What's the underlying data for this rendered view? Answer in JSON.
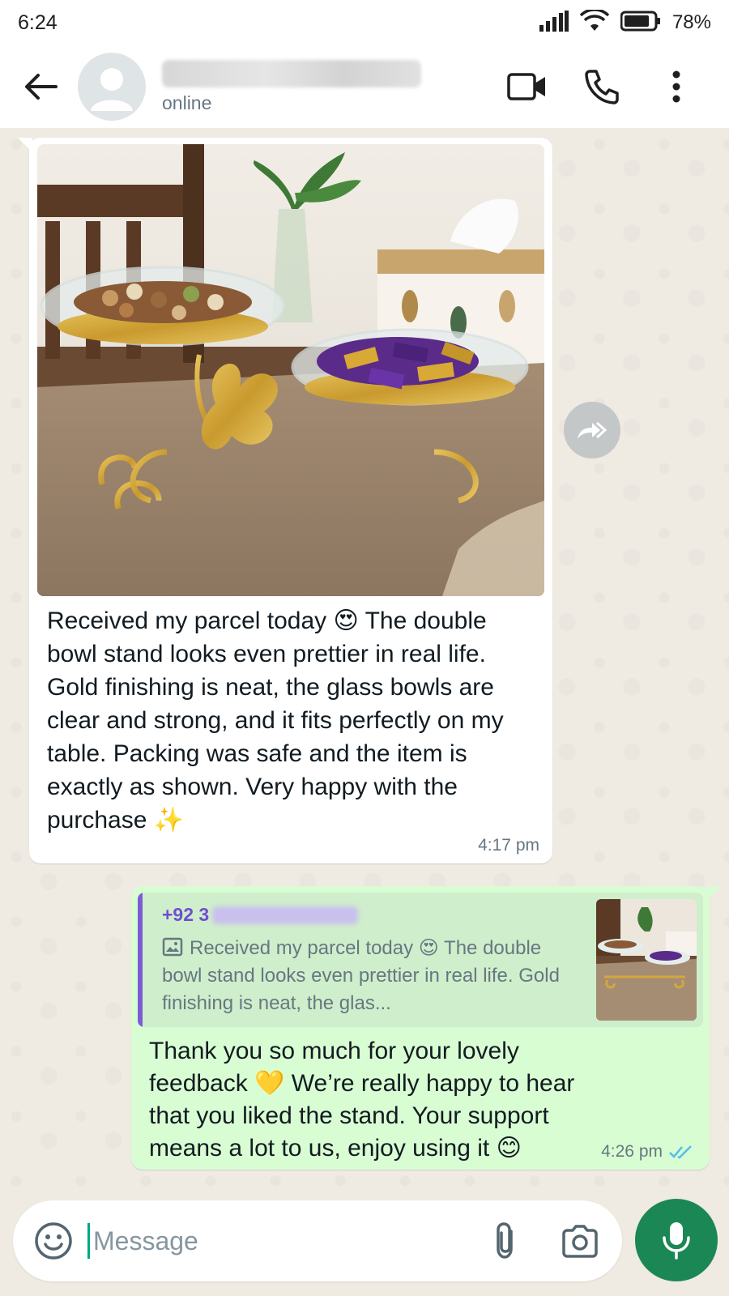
{
  "status_bar": {
    "time": "6:24",
    "battery": "78%"
  },
  "header": {
    "contact_status": "online",
    "icons": [
      "back-arrow-icon",
      "avatar-placeholder-icon",
      "video-call-icon",
      "voice-call-icon",
      "more-options-icon"
    ]
  },
  "messages": {
    "incoming": {
      "text": "Received my parcel today 😍 The double bowl stand looks even prettier in real life. Gold finishing is neat, the glass bowls are clear and strong, and it fits perfectly on my table. Packing was safe and the item is exactly as shown. Very happy with the purchase ✨",
      "time": "4:17 pm"
    },
    "outgoing": {
      "quote_sender": "+92 3",
      "quote_text": "Received my parcel today 😍 The double bowl stand looks even prettier in real life. Gold finishing is neat, the glas...",
      "text": "Thank you so much for your lovely feedback 💛 We’re really happy to hear that you liked the stand. Your support means a lot to us, enjoy using it 😊",
      "time": "4:26 pm",
      "status": "read"
    }
  },
  "input_bar": {
    "placeholder": "Message"
  },
  "colors": {
    "chat_background": "#efeae2",
    "outgoing_bubble": "#d9fdd3",
    "incoming_bubble": "#ffffff",
    "accent_green": "#1b8755",
    "read_ticks": "#53bdeb",
    "quote_accent": "#7c5cd6"
  }
}
